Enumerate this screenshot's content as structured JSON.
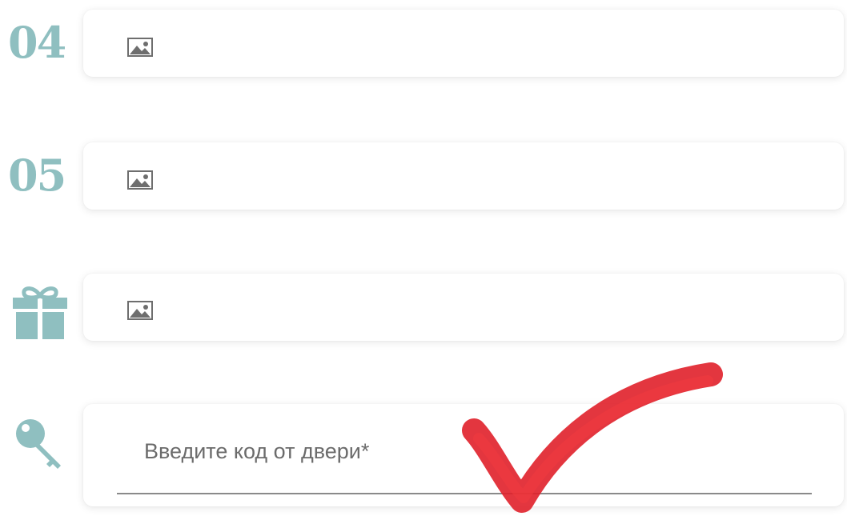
{
  "rows": [
    {
      "label": "04",
      "icon": "image-icon"
    },
    {
      "label": "05",
      "icon": "image-icon"
    },
    {
      "label": "",
      "icon": "gift-icon"
    },
    {
      "label": "",
      "icon": "key-icon"
    }
  ],
  "door_code": {
    "label": "Введите код от двери*",
    "value": ""
  },
  "colors": {
    "accent": "#8fbfc0",
    "checkmark": "#e0202a",
    "card_bg": "#ffffff",
    "label_text": "#6b6b6b"
  }
}
